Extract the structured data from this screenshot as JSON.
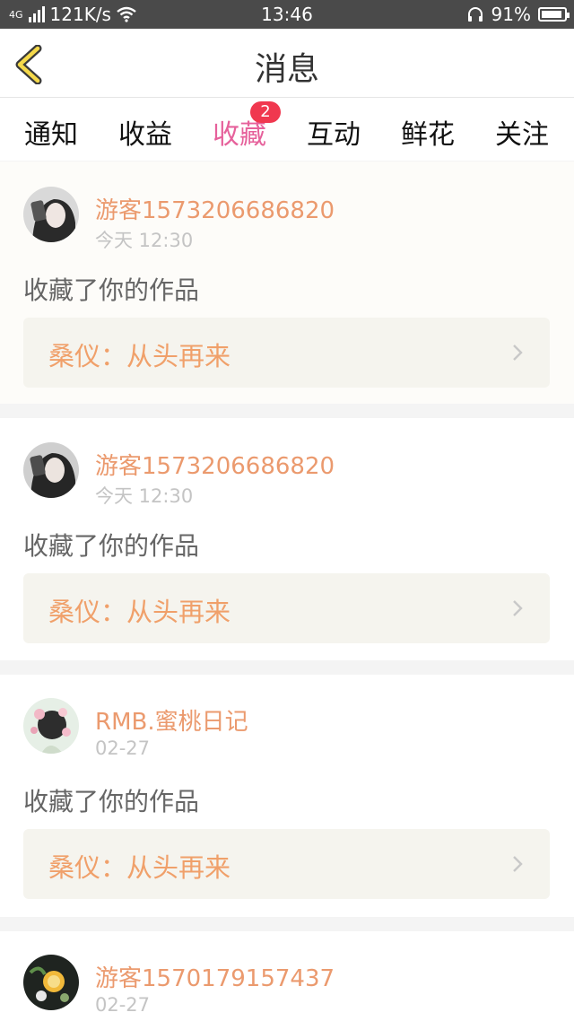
{
  "status_bar": {
    "network": "4G",
    "speed": "121K/s",
    "time": "13:46",
    "battery": "91%"
  },
  "header": {
    "title": "消息"
  },
  "tabs": [
    {
      "label": "通知"
    },
    {
      "label": "收益"
    },
    {
      "label": "收藏",
      "badge": "2",
      "active": true
    },
    {
      "label": "互动"
    },
    {
      "label": "鲜花"
    },
    {
      "label": "关注"
    }
  ],
  "colors": {
    "accent": "#e6619b",
    "badge": "#f0384f",
    "username": "#eb9a6e",
    "work_title": "#f0a06a"
  },
  "items": [
    {
      "username": "游客1573206686820",
      "time": "今天 12:30",
      "action": "收藏了你的作品",
      "work": "桑仪：从头再来"
    },
    {
      "username": "游客1573206686820",
      "time": "今天 12:30",
      "action": "收藏了你的作品",
      "work": "桑仪：从头再来"
    },
    {
      "username": "RMB.蜜桃日记",
      "time": "02-27",
      "action": "收藏了你的作品",
      "work": "桑仪：从头再来"
    },
    {
      "username": "游客1570179157437",
      "time": "02-27"
    }
  ]
}
